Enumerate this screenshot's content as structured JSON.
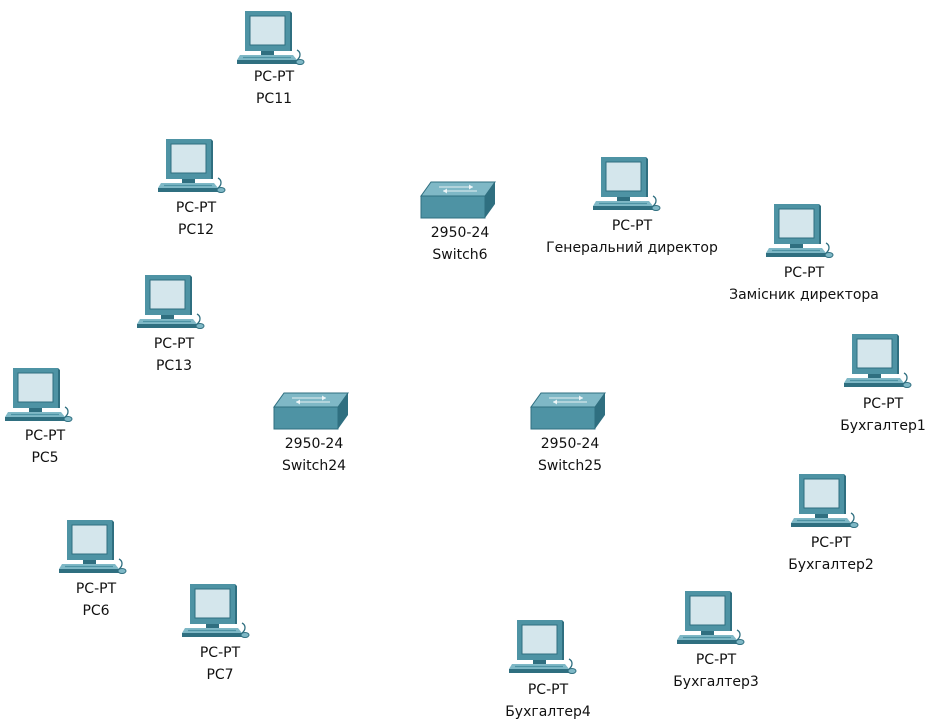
{
  "workspace": {
    "pcs": [
      {
        "id": "pc11",
        "model": "PC-PT",
        "name": "PC11"
      },
      {
        "id": "pc12",
        "model": "PC-PT",
        "name": "PC12"
      },
      {
        "id": "pc13",
        "model": "PC-PT",
        "name": "PC13"
      },
      {
        "id": "pc5",
        "model": "PC-PT",
        "name": "PC5"
      },
      {
        "id": "pc6",
        "model": "PC-PT",
        "name": "PC6"
      },
      {
        "id": "pc7",
        "model": "PC-PT",
        "name": "PC7"
      },
      {
        "id": "gen-dir",
        "model": "PC-PT",
        "name": "Генеральний директор"
      },
      {
        "id": "zam-dir",
        "model": "PC-PT",
        "name": "Замісник директора"
      },
      {
        "id": "buh1",
        "model": "PC-PT",
        "name": "Бухгалтер1"
      },
      {
        "id": "buh2",
        "model": "PC-PT",
        "name": "Бухгалтер2"
      },
      {
        "id": "buh3",
        "model": "PC-PT",
        "name": "Бухгалтер3"
      },
      {
        "id": "buh4",
        "model": "PC-PT",
        "name": "Бухгалтер4"
      }
    ],
    "switches": [
      {
        "id": "switch6",
        "model": "2950-24",
        "name": "Switch6"
      },
      {
        "id": "switch24",
        "model": "2950-24",
        "name": "Switch24"
      },
      {
        "id": "switch25",
        "model": "2950-24",
        "name": "Switch25"
      }
    ]
  },
  "colors": {
    "device_dark": "#2f6f80",
    "device_mid": "#4e93a4",
    "device_light": "#7fb8c6",
    "screen": "#d4e6ec",
    "label": "#111111"
  }
}
